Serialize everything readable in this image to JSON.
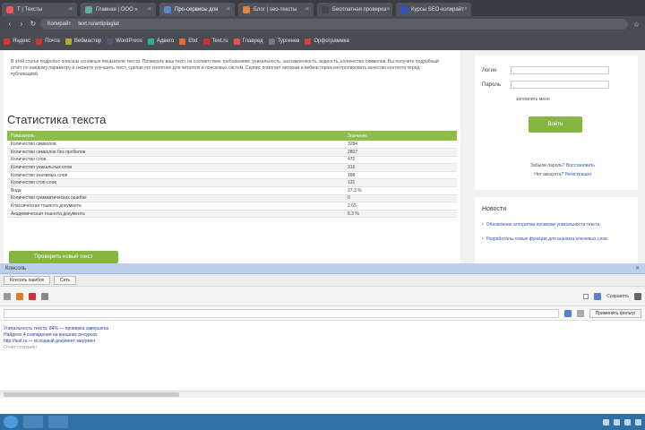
{
  "browser": {
    "tabs": [
      {
        "label": "Т | Тексты",
        "color": "#e55"
      },
      {
        "label": "Главная | ООО «",
        "color": "#6aa"
      },
      {
        "label": "Про-сервисы для",
        "color": "#58c"
      },
      {
        "label": "Блог | seo-тексты",
        "color": "#d84"
      },
      {
        "label": "Бесплатная проверка",
        "color": "#444"
      },
      {
        "label": "Курсы SEO-копирайт",
        "color": "#2a56c6"
      }
    ],
    "address": {
      "left": "Копирайт",
      "url": "text.ru/antiplagiat"
    },
    "bookmarks": [
      {
        "label": "Яндекс",
        "color": "#d33"
      },
      {
        "label": "Почта",
        "color": "#c33"
      },
      {
        "label": "Вебмастер",
        "color": "#aa3"
      },
      {
        "label": "WordPress",
        "color": "#557"
      },
      {
        "label": "Адвего",
        "color": "#3a9"
      },
      {
        "label": "Etxt",
        "color": "#e63"
      },
      {
        "label": "Text.ru",
        "color": "#c33"
      },
      {
        "label": "Главред",
        "color": "#d55"
      },
      {
        "label": "Тургенев",
        "color": "#777"
      },
      {
        "label": "Орфограммка",
        "color": "#c44"
      }
    ]
  },
  "main": {
    "intro_text": "В этой статье подробно описаны основные показатели текста. Проверьте ваш текст на соответствие требованиям: уникальность, заспамленность, водность, количество символов. Вы получите подробный отчёт по каждому параметру и сможете улучшить текст, сделав его понятнее для читателя и поисковых систем. Сервис помогает авторам и вебмастерам контролировать качество контента перед публикацией.",
    "section_title": "Статистика текста",
    "table": {
      "headers": [
        "Показатель",
        "Значение"
      ],
      "rows": [
        [
          "Количество символов",
          "3284"
        ],
        [
          "Количество символов без пробелов",
          "2807"
        ],
        [
          "Количество слов",
          "472"
        ],
        [
          "Количество уникальных слов",
          "316"
        ],
        [
          "Количество значимых слов",
          "198"
        ],
        [
          "Количество стоп-слов",
          "131"
        ],
        [
          "Вода",
          "27.3 %"
        ],
        [
          "Количество грамматических ошибок",
          "0"
        ],
        [
          "Классическая тошнота документа",
          "2.65"
        ],
        [
          "Академическая тошнота документа",
          "6.3 %"
        ]
      ]
    },
    "check_button": "Проверить новый текст"
  },
  "sidebar": {
    "login_label": "Логин",
    "password_label": "Пароль",
    "remember_label": "запомнить меня",
    "login_button": "Войти",
    "forgot_text": "Забыли пароль?",
    "forgot_link": "Восстановить",
    "register_text": "Нет аккаунта?",
    "register_link": "Регистрация",
    "news_title": "Новости",
    "news_items": [
      "Обновление алгоритма проверки уникальности текста",
      "Разработаны новые функции для анализа ключевых слов"
    ]
  },
  "console": {
    "title": "Консоль",
    "tabs": [
      "Консоль ошибок",
      "Сеть"
    ],
    "filter_button": "Применить фильтр",
    "toolbar_label": "Сохранять",
    "log_lines": [
      "Уникальность текста: 84% — проверка завершена",
      "Найдено 4 совпадения на внешних ресурсах",
      "http://text.ru — исходный документ загружен",
      "Отчёт сохранён"
    ]
  }
}
